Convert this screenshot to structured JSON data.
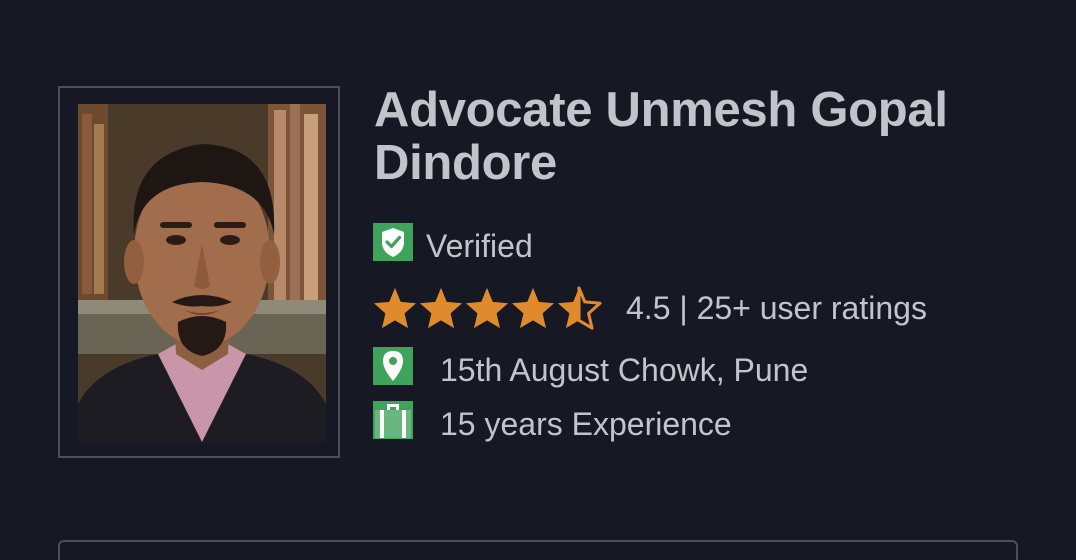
{
  "profile": {
    "name": "Advocate Unmesh Gopal Dindore",
    "verified_label": "Verified",
    "rating": 4.5,
    "rating_text": "4.5 | 25+ user ratings",
    "location": "15th August Chowk, Pune",
    "experience": "15 years Experience"
  },
  "icons": {
    "verified": "shield-check-icon",
    "location": "map-pin-icon",
    "experience": "briefcase-icon",
    "star": "star-icon"
  },
  "colors": {
    "background": "#161824",
    "text": "#c3c4c9",
    "star": "#e08a2e",
    "icon_green": "#3fa35b",
    "frame": "#4b4e5c"
  }
}
